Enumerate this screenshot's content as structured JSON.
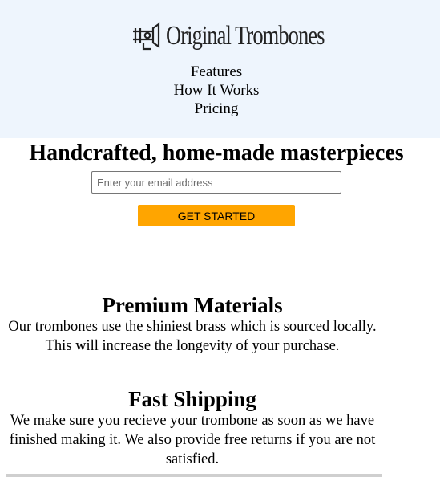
{
  "brand": {
    "name": "Original Trombones",
    "logo_icon": "trombone-logo-icon"
  },
  "nav": {
    "items": [
      "Features",
      "How It Works",
      "Pricing"
    ]
  },
  "hero": {
    "title": "Handcrafted, home-made masterpieces",
    "email_placeholder": "Enter your email address",
    "cta_label": "GET STARTED",
    "cta_color": "#ffa500"
  },
  "features": [
    {
      "title": "Premium Materials",
      "text": "Our trombones use the shiniest brass which is sourced locally. This will increase the longevity of your purchase."
    },
    {
      "title": "Fast Shipping",
      "text": "We make sure you recieve your trombone as soon as we have finished making it. We also provide free returns if you are not satisfied."
    }
  ],
  "colors": {
    "header_bg": "#eef5fd"
  }
}
